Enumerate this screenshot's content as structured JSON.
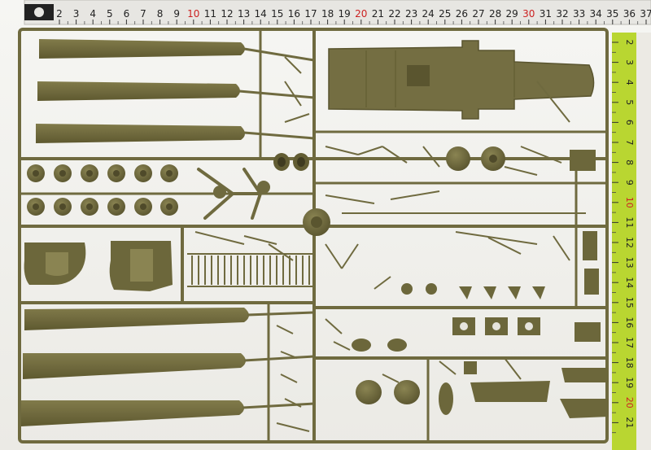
{
  "photo": {
    "subject": "plastic model kit sprue",
    "colors": {
      "background": "#f3f2ee",
      "plastic": "#6f6a3f",
      "plastic_dark": "#4f4a2a",
      "plastic_light": "#8a8452",
      "ruler_top": "#e9e8e4",
      "ruler_side": "#b9d631",
      "ruler_marks": "#222222",
      "ruler_red": "#cc2222"
    },
    "top_ruler": {
      "labels": [
        "2",
        "3",
        "4",
        "5",
        "6",
        "7",
        "8",
        "9",
        "10",
        "11",
        "12",
        "13",
        "14",
        "15",
        "16",
        "17",
        "18",
        "19",
        "20",
        "21",
        "22",
        "23",
        "24",
        "25",
        "26",
        "27",
        "28",
        "29",
        "30",
        "31",
        "32",
        "33",
        "34",
        "35",
        "36",
        "37"
      ],
      "red_labels": [
        "10",
        "20",
        "30"
      ]
    },
    "side_ruler": {
      "labels": [
        "2",
        "3",
        "4",
        "5",
        "6",
        "7",
        "8",
        "9",
        "10",
        "11",
        "12",
        "13",
        "14",
        "15",
        "16",
        "17",
        "18",
        "19",
        "20",
        "21"
      ],
      "red_labels": [
        "10",
        "20"
      ]
    }
  }
}
